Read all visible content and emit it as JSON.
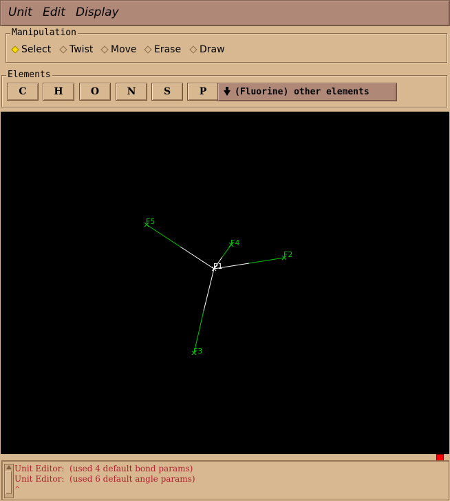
{
  "menubar": {
    "items": [
      {
        "label": "Unit"
      },
      {
        "label": "Edit"
      },
      {
        "label": "Display"
      }
    ]
  },
  "manipulation": {
    "title": "Manipulation",
    "options": [
      {
        "label": "Select",
        "selected": true
      },
      {
        "label": "Twist",
        "selected": false
      },
      {
        "label": "Move",
        "selected": false
      },
      {
        "label": "Erase",
        "selected": false
      },
      {
        "label": "Draw",
        "selected": false
      }
    ]
  },
  "elements": {
    "title": "Elements",
    "buttons": [
      "C",
      "H",
      "O",
      "N",
      "S",
      "P"
    ],
    "other_label": "(Fluorine) other elements"
  },
  "molecule": {
    "center_label": "P1",
    "atoms": [
      {
        "label": "F5"
      },
      {
        "label": "F4"
      },
      {
        "label": "F2"
      },
      {
        "label": "F3"
      }
    ],
    "bond_color_near": "#ffffff",
    "bond_color_far": "#00c800",
    "label_color": "#00c800"
  },
  "log": {
    "lines": [
      "Unit Editor:  (used 4 default bond params)",
      "Unit Editor:  (used 6 default angle params)"
    ]
  },
  "colors": {
    "background": "#d8b890",
    "menubar": "#b08878",
    "canvas": "#000000",
    "log_text": "#b02030",
    "indicator": "#ff0000",
    "radio_selected": "#f8e000"
  }
}
